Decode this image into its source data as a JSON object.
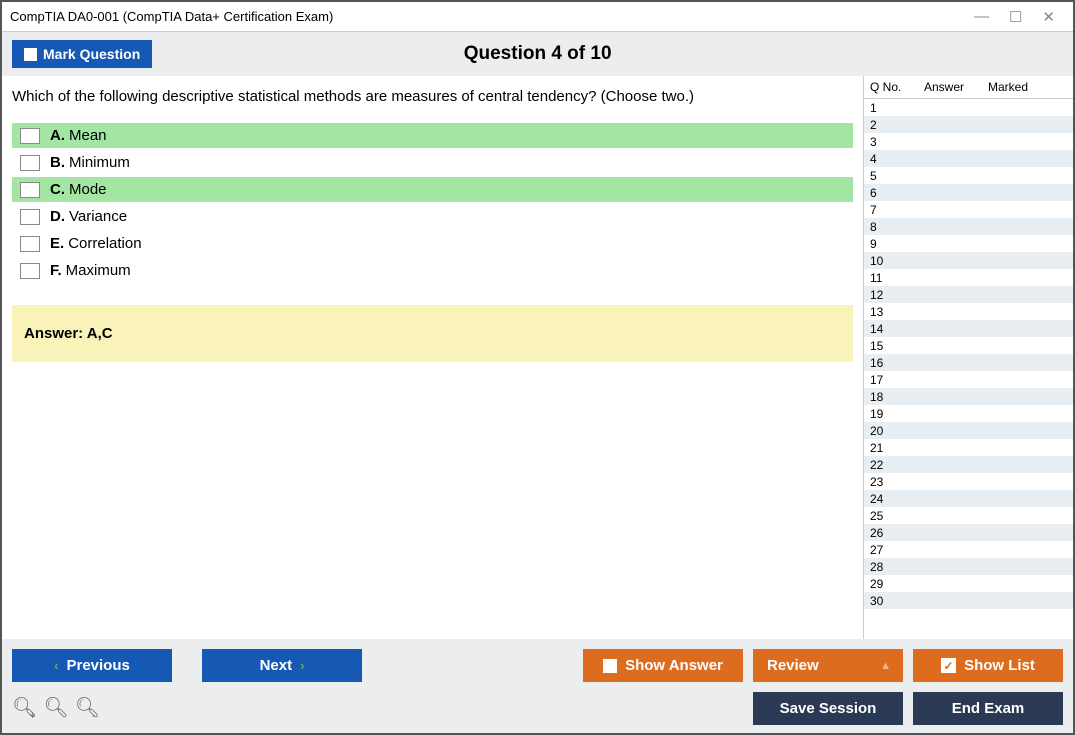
{
  "window_title": "CompTIA DA0-001 (CompTIA Data+ Certification Exam)",
  "header": {
    "mark_label": "Mark Question",
    "question_label": "Question 4 of 10"
  },
  "question": {
    "text": "Which of the following descriptive statistical methods are measures of central tendency? (Choose two.)",
    "options": [
      {
        "letter": "A.",
        "text": "Mean",
        "highlighted": true
      },
      {
        "letter": "B.",
        "text": "Minimum",
        "highlighted": false
      },
      {
        "letter": "C.",
        "text": "Mode",
        "highlighted": true
      },
      {
        "letter": "D.",
        "text": "Variance",
        "highlighted": false
      },
      {
        "letter": "E.",
        "text": "Correlation",
        "highlighted": false
      },
      {
        "letter": "F.",
        "text": "Maximum",
        "highlighted": false
      }
    ],
    "answer_label": "Answer: A,C"
  },
  "sidebar": {
    "headers": {
      "qno": "Q No.",
      "answer": "Answer",
      "marked": "Marked"
    },
    "rows": [
      1,
      2,
      3,
      4,
      5,
      6,
      7,
      8,
      9,
      10,
      11,
      12,
      13,
      14,
      15,
      16,
      17,
      18,
      19,
      20,
      21,
      22,
      23,
      24,
      25,
      26,
      27,
      28,
      29,
      30
    ]
  },
  "footer": {
    "previous": "Previous",
    "next": "Next",
    "show_answer": "Show Answer",
    "review": "Review",
    "show_list": "Show List",
    "save_session": "Save Session",
    "end_exam": "End Exam"
  }
}
